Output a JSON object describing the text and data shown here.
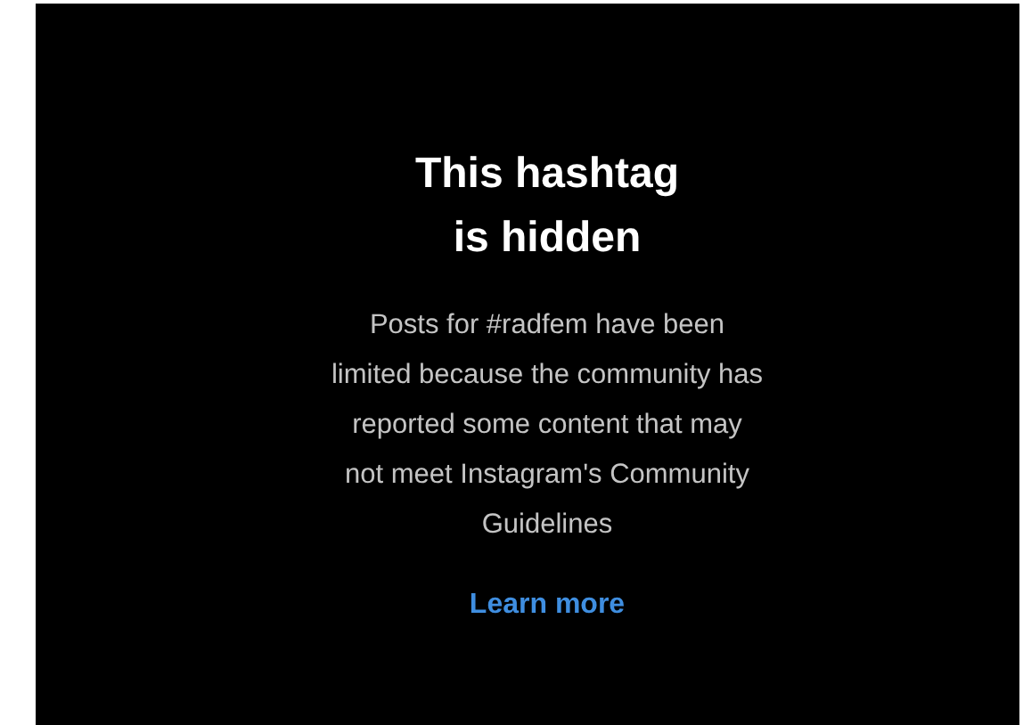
{
  "notice": {
    "title_lines": [
      "This hashtag",
      "is hidden"
    ],
    "body_lines": [
      "Posts for #radfem have been",
      "limited because the community has",
      "reported some content that may",
      "not meet Instagram's Community",
      "Guidelines"
    ],
    "link": "Learn more"
  }
}
